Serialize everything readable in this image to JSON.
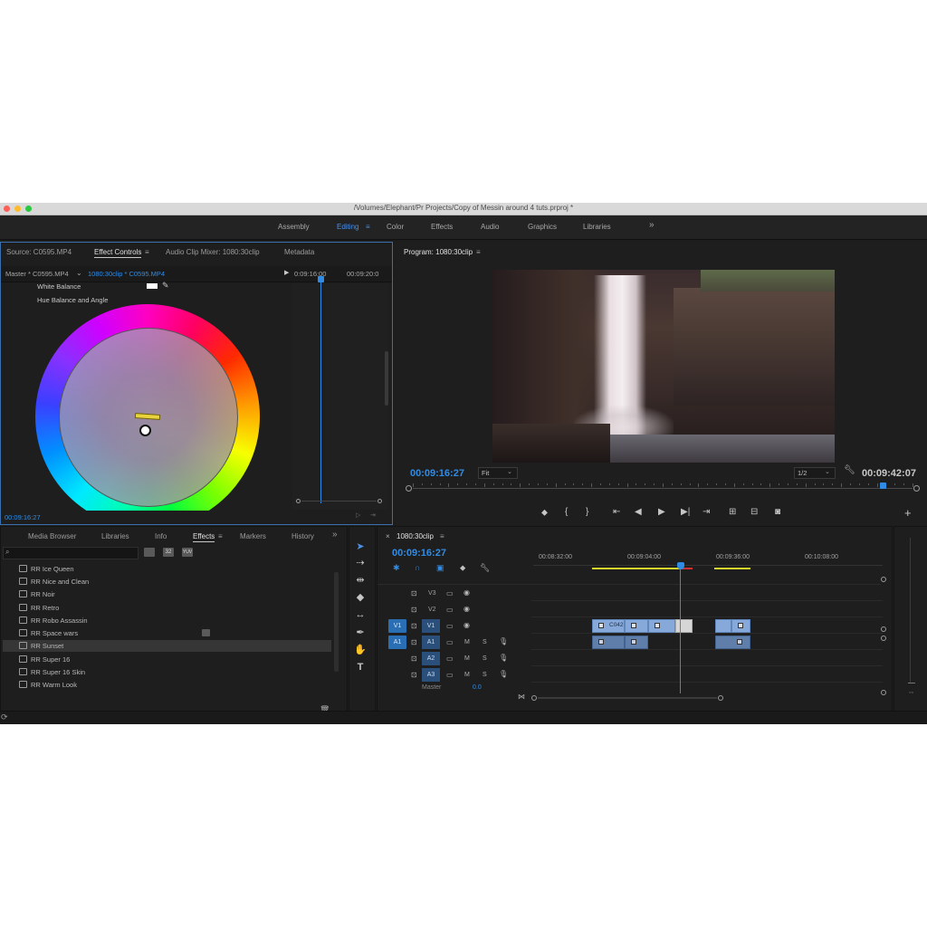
{
  "window": {
    "title": "/Volumes/Elephant/Pr Projects/Copy of Messin around 4 tuts.prproj *"
  },
  "workspaces": {
    "items": [
      "Assembly",
      "Editing",
      "Color",
      "Effects",
      "Audio",
      "Graphics",
      "Libraries"
    ],
    "active": "Editing",
    "more": "»",
    "menu_icon": "≡"
  },
  "source_panel": {
    "tabs": [
      "Source: C0595.MP4",
      "Effect Controls",
      "Audio Clip Mixer: 1080:30clip",
      "Metadata"
    ],
    "active_tab": "Effect Controls",
    "menu_icon": "≡",
    "master_label": "Master * C0595.MP4",
    "clip_label": "1080:30clip * C0595.MP4",
    "time_a": "0:09:16:00",
    "time_b": "00:09:20:0",
    "white_balance": "White Balance",
    "hue_balance": "Hue Balance and Angle",
    "timecode": "00:09:16:27"
  },
  "program_panel": {
    "title": "Program: 1080:30clip",
    "menu_icon": "≡",
    "current_time": "00:09:16:27",
    "fit": "Fit",
    "resolution": "1/2",
    "duration": "00:09:42:07",
    "playhead_fraction": 0.94
  },
  "effects_panel": {
    "tabs": [
      "Media Browser",
      "Libraries",
      "Info",
      "Effects",
      "Markers",
      "History"
    ],
    "active_tab": "Effects",
    "menu_icon": "≡",
    "more": "»",
    "items": [
      "RR Ice Queen",
      "RR Nice and Clean",
      "RR Noir",
      "RR Retro",
      "RR Robo Assassin",
      "RR Space wars",
      "RR Sunset",
      "RR Super 16",
      "RR Super 16 Skin",
      "RR Warm Look"
    ],
    "selected": "RR Sunset",
    "search_icons": [
      "32",
      "YUV"
    ]
  },
  "timeline": {
    "tab": "1080:30clip",
    "menu_icon": "≡",
    "timecode": "00:09:16:27",
    "ruler": [
      "00:08:32:00",
      "00:09:04:00",
      "00:09:36:00",
      "00:10:08:00"
    ],
    "tracks": {
      "video": [
        "V3",
        "V2",
        "V1"
      ],
      "audio": [
        "A1",
        "A2",
        "A3"
      ],
      "source_v": "V1",
      "source_a": "A1",
      "m": "M",
      "s": "S"
    },
    "clip_label": "C042",
    "master": "Master",
    "master_value": "0.0"
  },
  "colors": {
    "accent": "#2f8ce6",
    "clip_video": "#87a9d9",
    "clip_audio": "#5f7ea9",
    "panel": "#1e1e1e"
  }
}
